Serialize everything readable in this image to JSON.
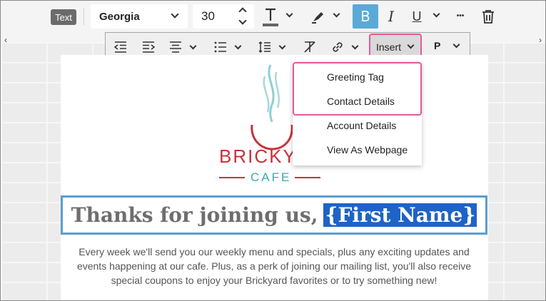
{
  "toolbar": {
    "text_badge": "Text",
    "font": "Georgia",
    "size": "30",
    "bold": "B",
    "italic": "I",
    "underline": "U",
    "more": "•••",
    "insert_label": "Insert",
    "paragraph_label": "P"
  },
  "dropdown": {
    "items": [
      "Greeting Tag",
      "Contact Details",
      "Account Details",
      "View As Webpage"
    ]
  },
  "logo": {
    "brick": "BRICKYA",
    "cafe": "CAFE"
  },
  "email": {
    "headline_prefix": "Thanks for joining us,",
    "headline_tag": "{First Name}",
    "body": "Every week we'll send you our weekly menu and specials, plus any exciting updates and events happening at our cafe. Plus, as a perk of joining our mailing list, you'll also receive special coupons to enjoy your Brickyard favorites or to try something new!"
  },
  "colors": {
    "accent_blue": "#5aaad8",
    "highlight_pink": "#e9579a",
    "selection_blue": "#1e63c8",
    "logo_red": "#c7323c",
    "logo_teal": "#3aa9ad"
  }
}
